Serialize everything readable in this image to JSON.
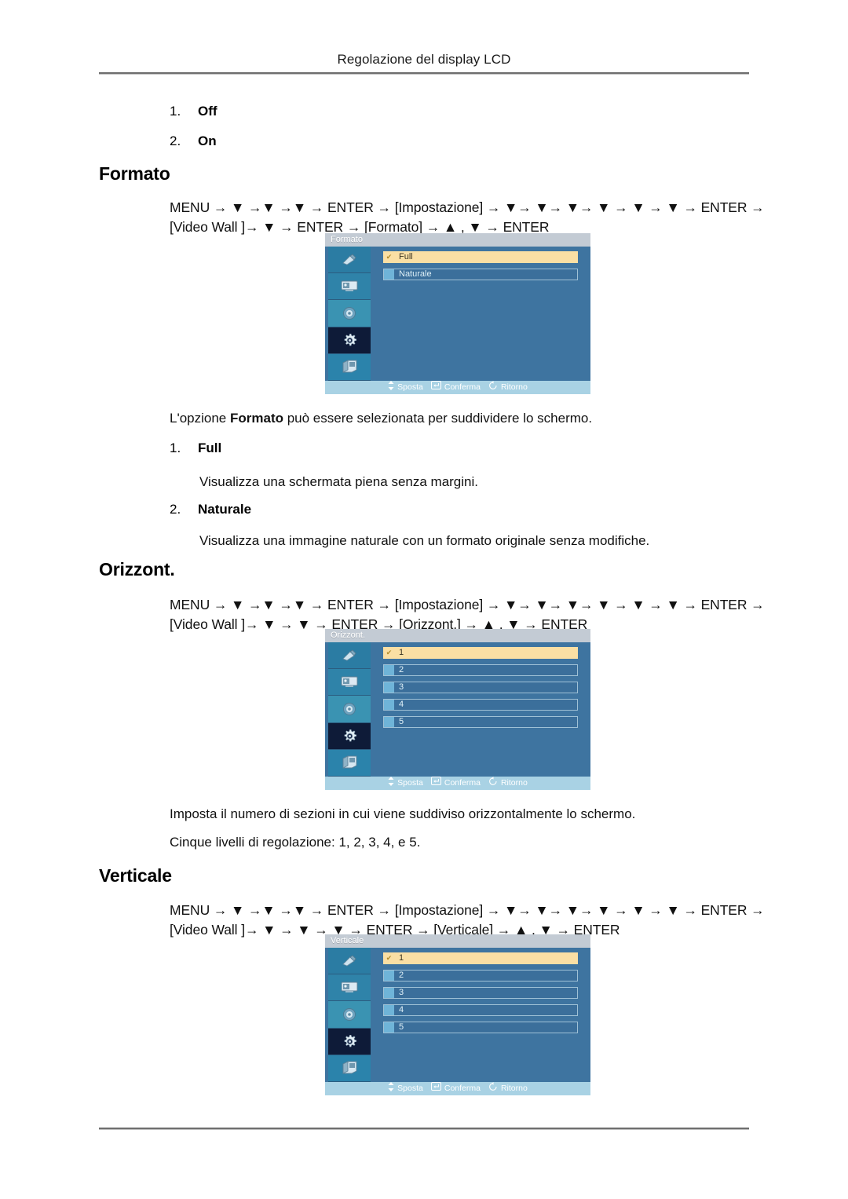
{
  "header": {
    "title": "Regolazione del display LCD"
  },
  "top_list": [
    {
      "num": "1.",
      "label": "Off"
    },
    {
      "num": "2.",
      "label": "On"
    }
  ],
  "sections": [
    {
      "heading": "Formato",
      "path_line1_prefix": "MENU → ",
      "path_line1": "MENU → ▼ →▼ →▼ → ENTER → [Impostazione] → ▼→ ▼→ ▼→ ▼ → ▼ → ▼ → ENTER →",
      "path_line2": "[Video Wall ]→ ▼ → ENTER → [Formato] → ▲ , ▼ → ENTER",
      "osd": {
        "title": "Formato",
        "items": [
          {
            "label": "Full",
            "selected": true
          },
          {
            "label": "Naturale",
            "selected": false
          }
        ]
      },
      "body": [
        {
          "type": "para",
          "text_before": "L'opzione ",
          "bold": "Formato",
          "text_after": " può essere selezionata per suddividere lo schermo."
        },
        {
          "type": "numitem",
          "num": "1.",
          "label": "Full"
        },
        {
          "type": "para",
          "text_before": "Visualizza una schermata piena senza margini.",
          "bold": "",
          "text_after": ""
        },
        {
          "type": "numitem",
          "num": "2.",
          "label": "Naturale"
        },
        {
          "type": "para",
          "text_before": "Visualizza una immagine naturale con un formato originale senza modifiche.",
          "bold": "",
          "text_after": ""
        }
      ]
    },
    {
      "heading": "Orizzont.",
      "path_line1": "MENU → ▼ →▼ →▼ → ENTER → [Impostazione] → ▼→ ▼→ ▼→ ▼ → ▼ → ▼ → ENTER →",
      "path_line2": "[Video Wall ]→ ▼ → ▼ → ENTER → [Orizzont.] → ▲ , ▼ → ENTER",
      "osd": {
        "title": "Orizzont.",
        "items": [
          {
            "label": "1",
            "selected": true
          },
          {
            "label": "2",
            "selected": false
          },
          {
            "label": "3",
            "selected": false
          },
          {
            "label": "4",
            "selected": false
          },
          {
            "label": "5",
            "selected": false
          }
        ]
      },
      "body": [
        {
          "type": "para",
          "text_before": "Imposta il numero di sezioni in cui viene suddiviso orizzontalmente lo schermo.",
          "bold": "",
          "text_after": ""
        },
        {
          "type": "para",
          "text_before": "Cinque livelli di regolazione: 1, 2, 3, 4, e 5.",
          "bold": "",
          "text_after": ""
        }
      ]
    },
    {
      "heading": "Verticale",
      "path_line1": "MENU → ▼ →▼ →▼ → ENTER → [Impostazione] → ▼→ ▼→ ▼→ ▼ → ▼ → ▼ → ENTER →",
      "path_line2": "[Video Wall ]→ ▼ → ▼ → ▼ → ENTER → [Verticale] → ▲ , ▼ → ENTER",
      "osd": {
        "title": "Verticale",
        "items": [
          {
            "label": "1",
            "selected": true
          },
          {
            "label": "2",
            "selected": false
          },
          {
            "label": "3",
            "selected": false
          },
          {
            "label": "4",
            "selected": false
          },
          {
            "label": "5",
            "selected": false
          }
        ]
      },
      "body": []
    }
  ],
  "osd_footer": {
    "move": "Sposta",
    "confirm": "Conferma",
    "return": "Ritorno"
  },
  "osd_icons": [
    "picture-icon",
    "display-icon",
    "sound-icon",
    "setup-gear-icon",
    "multi-control-icon"
  ],
  "osd_check_glyph": "✔",
  "colors": {
    "osd_background": "#3e74a0",
    "osd_titlebar": "#c3cbd4",
    "osd_footer": "#a9d2e4",
    "osd_selected_row": "#fadfa4",
    "osd_chip": "#6fb4d8",
    "osd_active_icon": "#0e1b38",
    "rule": "#6e6e6e"
  }
}
